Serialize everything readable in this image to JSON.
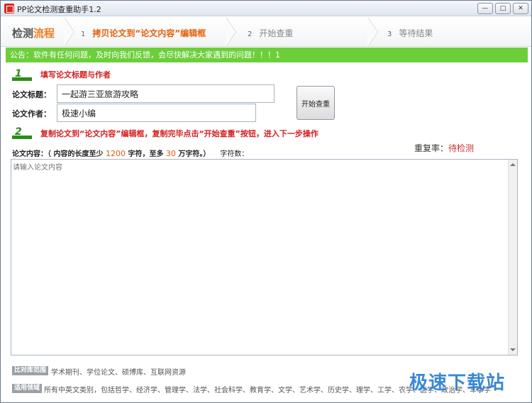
{
  "window": {
    "title": "PP论文检测查重助手1.2",
    "min_glyph": "—",
    "max_glyph": "□",
    "close_glyph": "✕"
  },
  "stepbar": {
    "title_part1": "检测",
    "title_part2": "流程",
    "steps": [
      {
        "num": "1",
        "label": "拷贝论文到“论文内容”编辑框",
        "active": true
      },
      {
        "num": "2",
        "label": "开始查重",
        "active": false
      },
      {
        "num": "3",
        "label": "等待结果",
        "active": false
      }
    ]
  },
  "notice": "公告：软件有任何问题，及时向我们反馈，会尽快解决大家遇到的问题！！！1",
  "section1": {
    "digit": "1",
    "heading": "填写论文标题与作者"
  },
  "form": {
    "title_label": "论文标题：",
    "title_value": "一起游三亚旅游攻略",
    "author_label": "论文作者：",
    "author_value": "极速小编"
  },
  "start_button": "开始查重",
  "section2": {
    "digit": "2",
    "heading": "复制论文到“论文内容”编辑框，复制完毕点击“开始查重”按钮，进入下一步操作"
  },
  "rate": {
    "label": "重复率：",
    "value": "待检测"
  },
  "content_info": {
    "prefix": "论文内容：（ 内容的长度至少 ",
    "min": "1200",
    "mid": " 字符，至多 ",
    "max": "30",
    "suffix": " 万字符。）",
    "char_count_label": "字符数："
  },
  "content_placeholder": "请输入论文内容",
  "footer": {
    "tag1": "比对库范围",
    "line1": "学术期刊、学位论文、硕博库、互联网资源",
    "tag2": "适用领域",
    "line2": "所有中英文类别，包括哲学、经济学、管理学、法学、社会科学、教育学、文学、艺术学、历史学、理学、工学、农学、医学、政治学、军事学"
  },
  "watermark": "极速下载站"
}
